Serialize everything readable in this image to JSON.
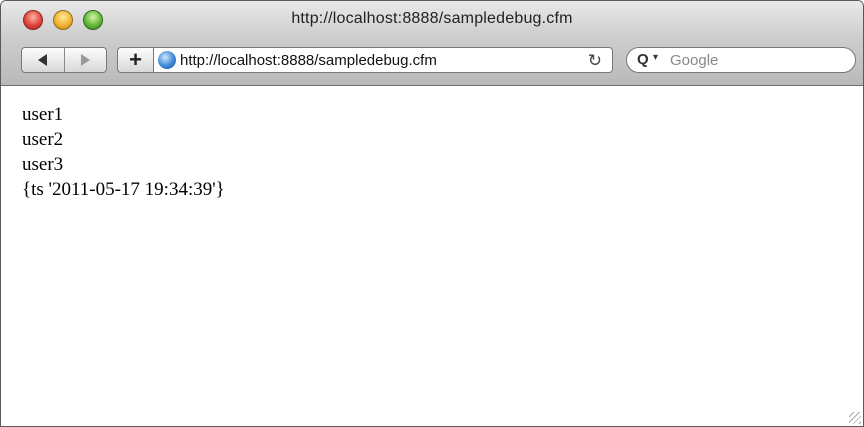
{
  "window": {
    "title": "http://localhost:8888/sampledebug.cfm"
  },
  "toolbar": {
    "back_icon": "back-arrow-icon",
    "forward_icon": "forward-arrow-icon",
    "add_label": "+",
    "url": "http://localhost:8888/sampledebug.cfm",
    "reload_glyph": "↻",
    "search_placeholder": "Google",
    "search_icon": "magnifier-icon"
  },
  "content": {
    "lines": [
      "user1",
      "user2",
      "user3",
      "{ts '2011-05-17 19:34:39'}"
    ]
  },
  "colors": {
    "close": "#e0443a",
    "minimize": "#f0b32f",
    "zoom": "#63b83a"
  }
}
